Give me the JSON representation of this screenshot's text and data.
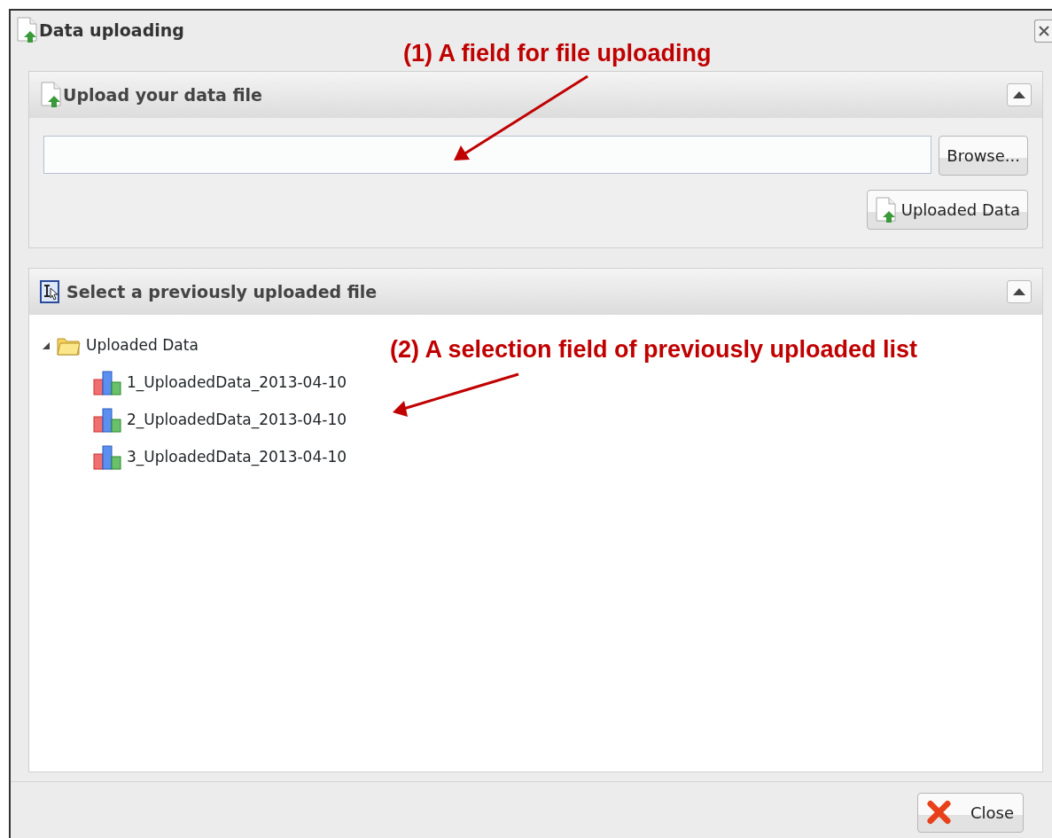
{
  "window": {
    "title": "Data uploading"
  },
  "upload_panel": {
    "title": "Upload your data file",
    "expanded": true,
    "browse_button": "Browse...",
    "uploaded_button": "Uploaded Data"
  },
  "select_panel": {
    "title": "Select a previously uploaded file",
    "expanded": true,
    "tree": [
      {
        "label": "Uploaded Data",
        "kind": "folder",
        "expanded": true,
        "children": [
          {
            "label": "1_UploadedData_2013-04-10",
            "kind": "dataset"
          },
          {
            "label": "2_UploadedData_2013-04-10",
            "kind": "dataset"
          },
          {
            "label": "3_UploadedData_2013-04-10",
            "kind": "dataset"
          }
        ]
      }
    ]
  },
  "footer": {
    "close_button": "Close"
  },
  "annotations": [
    {
      "text": "(1) A field for file uploading"
    },
    {
      "text": "(2) A selection field of previously uploaded list"
    }
  ]
}
